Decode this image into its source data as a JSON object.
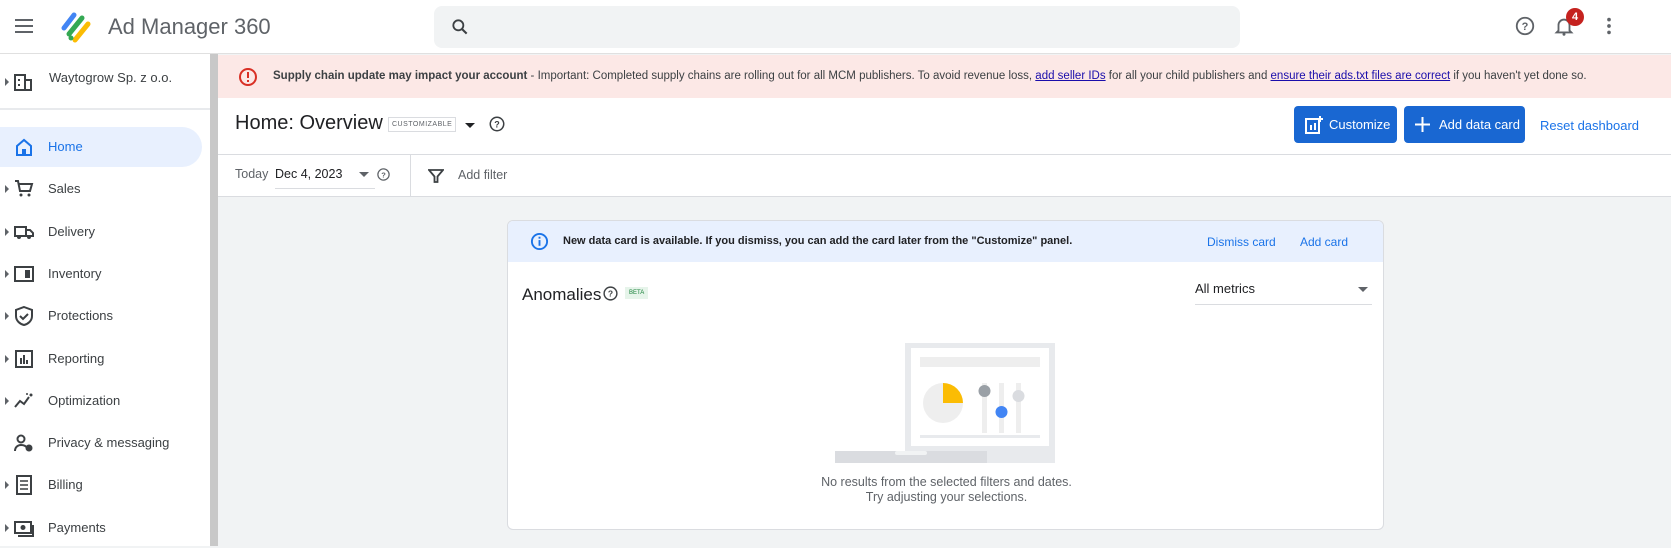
{
  "header": {
    "app_name": "Ad Manager 360",
    "search_placeholder": "",
    "notification_count": "4"
  },
  "sidebar": {
    "account": "Waytogrow Sp. z o.o.",
    "items": [
      {
        "label": "Home",
        "icon": "home-icon",
        "active": true,
        "expandable": false
      },
      {
        "label": "Sales",
        "icon": "cart-icon",
        "expandable": true
      },
      {
        "label": "Delivery",
        "icon": "truck-icon",
        "expandable": true
      },
      {
        "label": "Inventory",
        "icon": "inventory-icon",
        "expandable": true
      },
      {
        "label": "Protections",
        "icon": "shield-icon",
        "expandable": true
      },
      {
        "label": "Reporting",
        "icon": "chart-icon",
        "expandable": true
      },
      {
        "label": "Optimization",
        "icon": "optimization-icon",
        "expandable": true
      },
      {
        "label": "Privacy & messaging",
        "icon": "privacy-icon",
        "expandable": false
      },
      {
        "label": "Billing",
        "icon": "billing-icon",
        "expandable": true
      },
      {
        "label": "Payments",
        "icon": "payments-icon",
        "expandable": true
      }
    ]
  },
  "banner": {
    "title": "Supply chain update may impact your account",
    "text1": " - Important: Completed supply chains are rolling out for all MCM publishers. To avoid revenue loss, ",
    "link1": "add seller IDs",
    "text2": " for all your child publishers and ",
    "link2": "ensure their ads.txt files are correct",
    "text3": " if you haven't yet done so."
  },
  "page": {
    "title": "Home: Overview",
    "tag": "CUSTOMIZABLE",
    "customize": "Customize",
    "add_data_card": "Add data card",
    "reset": "Reset dashboard"
  },
  "filters": {
    "date_label": "Today",
    "date_value": "Dec 4, 2023",
    "add_filter": "Add filter"
  },
  "card": {
    "info": "New data card is available. If you dismiss, you can add the card later from the \"Customize\" panel.",
    "dismiss": "Dismiss card",
    "add": "Add card",
    "title": "Anomalies",
    "beta": "BETA",
    "metrics": "All metrics",
    "empty1": "No results from the selected filters and dates.",
    "empty2": "Try adjusting your selections."
  },
  "colors": {
    "primary": "#1967d2",
    "error": "#d93025",
    "banner_bg": "#fce8e6"
  }
}
